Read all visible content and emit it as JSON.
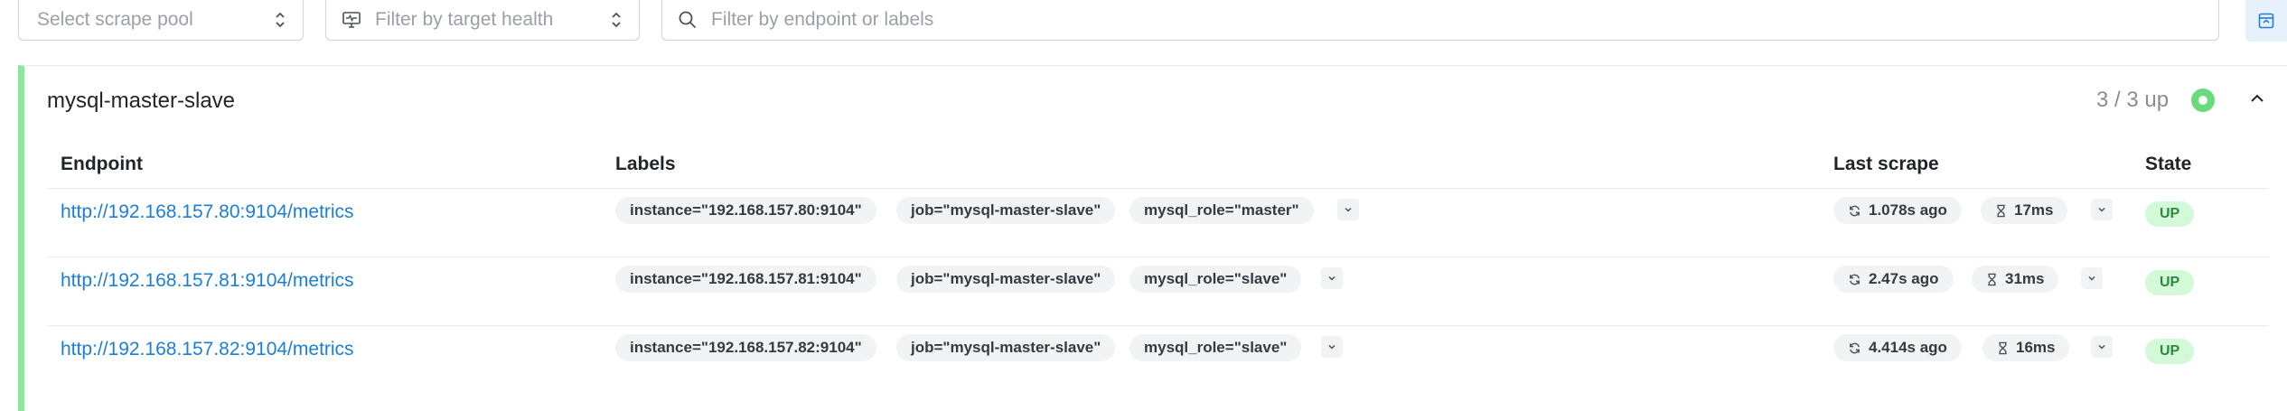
{
  "filters": {
    "scrape_pool_placeholder": "Select scrape pool",
    "health_placeholder": "Filter by target health",
    "search_placeholder": "Filter by endpoint or labels"
  },
  "pool": {
    "name": "mysql-master-slave",
    "count": "3 / 3 up",
    "status_color": "#69db7c",
    "border_color": "#8ce99a"
  },
  "table": {
    "headers": {
      "endpoint": "Endpoint",
      "labels": "Labels",
      "last_scrape": "Last scrape",
      "state": "State"
    },
    "rows": [
      {
        "endpoint": "http://192.168.157.80:9104/metrics",
        "labels": [
          "instance=\"192.168.157.80:9104\"",
          "job=\"mysql-master-slave\"",
          "mysql_role=\"master\""
        ],
        "last_scrape": "1.078s ago",
        "duration": "17ms",
        "state": "UP"
      },
      {
        "endpoint": "http://192.168.157.81:9104/metrics",
        "labels": [
          "instance=\"192.168.157.81:9104\"",
          "job=\"mysql-master-slave\"",
          "mysql_role=\"slave\""
        ],
        "last_scrape": "2.47s ago",
        "duration": "31ms",
        "state": "UP"
      },
      {
        "endpoint": "http://192.168.157.82:9104/metrics",
        "labels": [
          "instance=\"192.168.157.82:9104\"",
          "job=\"mysql-master-slave\"",
          "mysql_role=\"slave\""
        ],
        "last_scrape": "4.414s ago",
        "duration": "16ms",
        "state": "UP"
      }
    ]
  },
  "colors": {
    "link": "#1c7ed6",
    "up_badge_bg": "#d3f9d8",
    "up_badge_text": "#2b8a3e"
  }
}
